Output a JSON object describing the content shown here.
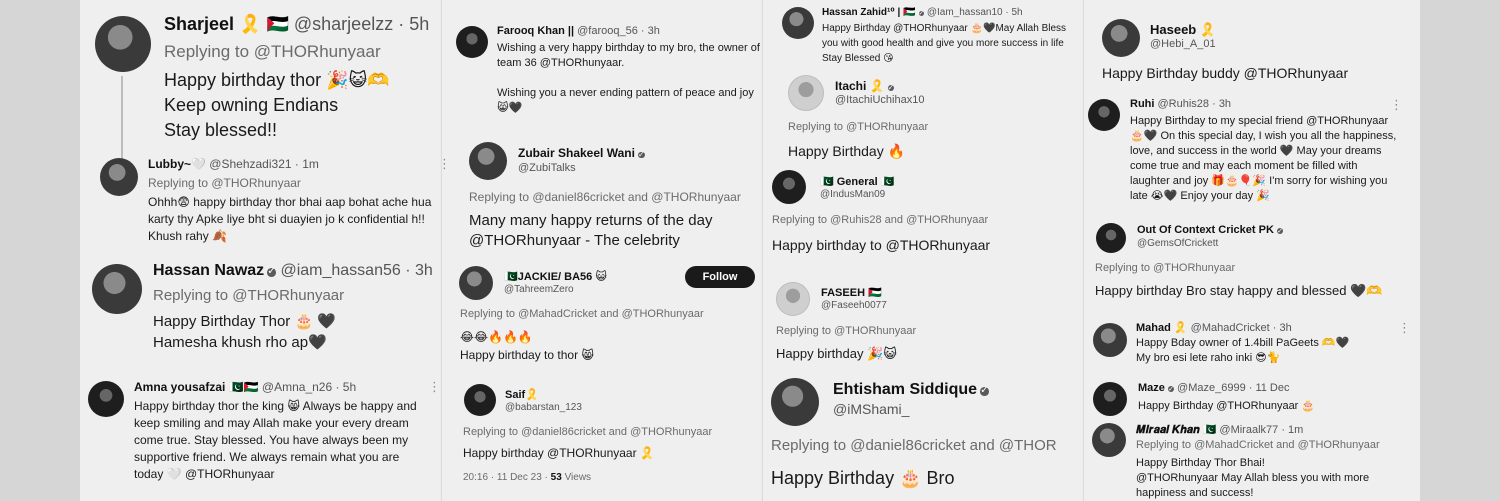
{
  "tweets": [
    {
      "name": "Sharjeel 🎗️ 🇵🇸",
      "handle": "@sharjeelzz · 5h",
      "reply": "Replying to @THORhunyaar",
      "body": [
        "Happy birthday thor 🎉😺🫶",
        "Keep owning Endians",
        "Stay blessed!!"
      ]
    },
    {
      "name": "Lubby~🤍",
      "handle": "@Shehzadi321 · 1m",
      "reply": "Replying to @THORhunyaar",
      "body": [
        "Ohhh😨 happy birthday thor bhai aap bohat ache hua",
        "karty thy Apke liye bht si duayien jo k confidential h!!",
        "Khush rahy 🍂"
      ]
    },
    {
      "name": "Hassan Nawaz",
      "handle": "@iam_hassan56 · 3h",
      "reply": "Replying to @THORhunyaar",
      "body": [
        "Happy Birthday Thor 🎂 🖤",
        "Hamesha khush rho ap🖤"
      ]
    },
    {
      "name": "Amna yousafzai 🇵🇰🇵🇸",
      "handle": "@Amna_n26 · 5h",
      "reply": "",
      "body": [
        "Happy birthday thor the king 😸 Always be happy and",
        "keep smiling and may Allah make your every dream",
        "come true. Stay blessed. You have always been my",
        "supportive friend. We always remain what you are",
        "today 🤍 @THORhunyaar"
      ]
    },
    {
      "name": "Farooq Khan ||",
      "handle": "@farooq_56 · 3h",
      "reply": "",
      "body": [
        "Wishing a very happy birthday to my bro, the owner of",
        "team 36 @THORhunyaar.",
        "",
        "Wishing you a never ending pattern of peace and joy",
        "😸🖤"
      ]
    },
    {
      "name": "Zubair Shakeel Wani",
      "handle": "@ZubiTalks",
      "reply": "Replying to @daniel86cricket and @THORhunyaar",
      "body": [
        "Many many happy returns of the day",
        "@THORhunyaar - The celebrity"
      ]
    },
    {
      "name": "🇵🇰JACKIE/ BA56 😺",
      "handle": "@TahreemZero",
      "reply": "Replying to @MahadCricket and @THORhunyaar",
      "body": [
        "😂😂🔥🔥🔥",
        "Happy birthday to thor 😸"
      ],
      "follow": "Follow"
    },
    {
      "name": "Saif🎗️",
      "handle": "@babarstan_123",
      "reply": "Replying to @daniel86cricket and @THORhunyaar",
      "body": [
        "Happy birthday @THORhunyaar 🎗️"
      ],
      "meta_time": "20:16 · 11 Dec 23 ·",
      "meta_views": "53",
      "meta_views_label": "Views"
    },
    {
      "name": "Hassan Zahid¹⁰ | 🇵🇸",
      "handle": "@Iam_hassan10 · 5h",
      "reply": "",
      "body": [
        "Happy Birthday @THORhunyaar 🎂🖤May Allah Bless",
        "you with good health and give you more success in life",
        "Stay Blessed 😘"
      ]
    },
    {
      "name": "Itachi 🎗️",
      "handle": "@ItachiUchihax10",
      "reply": "Replying to @THORhunyaar",
      "body": [
        "Happy Birthday 🔥"
      ]
    },
    {
      "name": "🇵🇰 General 🇵🇰",
      "handle": "@IndusMan09",
      "reply": "Replying to @Ruhis28 and @THORhunyaar",
      "body": [
        "Happy birthday to @THORhunyaar"
      ]
    },
    {
      "name": "FASEEH 🇵🇸",
      "handle": "@Faseeh0077",
      "reply": "Replying to @THORhunyaar",
      "body": [
        "Happy birthday 🎉😺"
      ]
    },
    {
      "name": "Ehtisham Siddique",
      "handle": "@iMShami_",
      "reply": "Replying to @daniel86cricket and @THOR",
      "body": [
        "Happy Birthday 🎂 Bro"
      ]
    },
    {
      "name": "Haseeb 🎗️",
      "handle": "@Hebi_A_01",
      "reply": "",
      "body": [
        "Happy Birthday buddy @THORhunyaar"
      ]
    },
    {
      "name": "Ruhi",
      "handle": "@Ruhis28 · 3h",
      "reply": "",
      "body": [
        "Happy Birthday to my special friend @THORhunyaar",
        "🎂🖤 On this special day, I wish you all the happiness,",
        "love, and success in the world 🖤 May your dreams",
        "come true and may each moment be filled with",
        "laughter and joy 🎁🎂🎈🎉 I'm sorry for wishing you",
        "late 😭🖤 Enjoy your day 🎉"
      ]
    },
    {
      "name": "Out Of Context Cricket PK",
      "handle": "@GemsOfCrickett",
      "reply": "Replying to @THORhunyaar",
      "body": [
        "Happy birthday Bro stay happy and blessed 🖤🫶"
      ]
    },
    {
      "name": "Mahad 🎗️",
      "handle": "@MahadCricket · 3h",
      "reply": "",
      "body": [
        "Happy Bday owner of 1.4bill PaGeets 🫶🖤",
        "My bro esi lete raho inki 😎🐈"
      ]
    },
    {
      "name": "Maze",
      "handle": "@Maze_6999 · 11 Dec",
      "reply": "",
      "body": [
        "Happy Birthday @THORhunyaar 🎂"
      ]
    },
    {
      "name": "𝑴𝒊𝒓𝒂𝒂𝒍 𝑲𝒉𝒂𝒏 🇵🇰",
      "handle": "@Miraalk77 · 1m",
      "reply": "Replying to @MahadCricket and @THORhunyaar",
      "body": [
        "Happy Birthday Thor Bhai!",
        "@THORhunyaar  May Allah bless you with more",
        "happiness and success!"
      ]
    }
  ],
  "icons": {
    "verified": "verified-badge-icon",
    "more": "more-options-icon"
  },
  "colors": {
    "page_bg": "#d6d6d6",
    "card_bg": "#efefef",
    "text": "#1b1b1b",
    "muted": "#6b6b6b"
  }
}
